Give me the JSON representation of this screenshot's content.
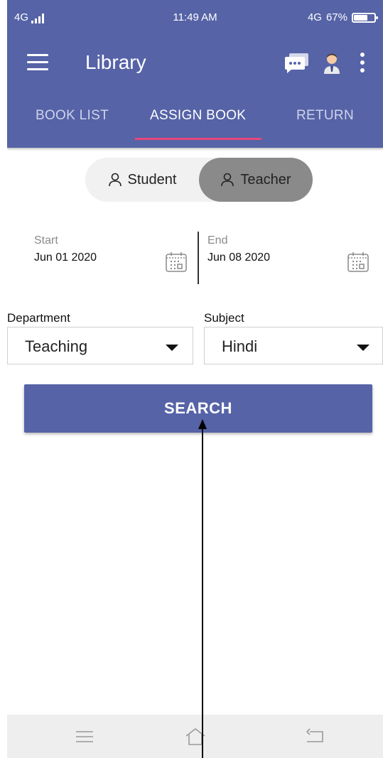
{
  "status_bar": {
    "network": "4G",
    "time": "11:49 AM",
    "network_right": "4G",
    "battery": "67%",
    "battery_level": 0.67
  },
  "app_bar": {
    "title": "Library",
    "icons": [
      "menu-icon",
      "chat-icon",
      "user-avatar-icon",
      "more-vert-icon"
    ]
  },
  "tabs": [
    {
      "label": "BOOK LIST",
      "active": false
    },
    {
      "label": "ASSIGN BOOK",
      "active": true
    },
    {
      "label": "RETURN",
      "active": false
    }
  ],
  "toggle": {
    "student_label": "Student",
    "teacher_label": "Teacher",
    "selected": "Teacher",
    "icon": "person-outline-icon"
  },
  "dates": {
    "start_label": "Start",
    "start_value": "Jun 01 2020",
    "end_label": "End",
    "end_value": "Jun 08 2020"
  },
  "filters": {
    "department_label": "Department",
    "department_value": "Teaching",
    "subject_label": "Subject",
    "subject_value": "Hindi"
  },
  "search_button": {
    "label": "SEARCH"
  },
  "colors": {
    "primary": "#5663a7",
    "tab_indicator": "#e8477b",
    "toggle_selected": "#8a8a8a",
    "nav_bar": "#eeeeee"
  }
}
